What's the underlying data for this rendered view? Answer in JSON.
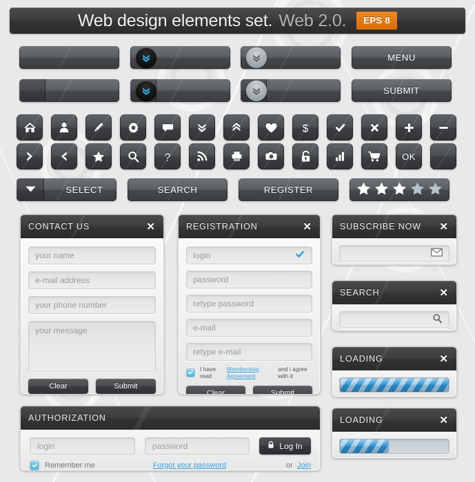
{
  "header": {
    "title_main": "Web design elements set.",
    "title_sub": "Web 2.0.",
    "badge": "EPS 8"
  },
  "buttons": {
    "row1": [
      {
        "name": "plain-button-1",
        "label": ""
      },
      {
        "name": "dropdown-button-dark",
        "label": "",
        "icon": "double-chevron-down-icon"
      },
      {
        "name": "dropdown-button-grey",
        "label": "",
        "icon": "double-chevron-down-icon"
      },
      {
        "name": "menu-button",
        "label": "MENU"
      }
    ],
    "row2": [
      {
        "name": "split-button-1",
        "label": ""
      },
      {
        "name": "split-dropdown-button-dark",
        "label": "",
        "icon": "double-chevron-down-icon"
      },
      {
        "name": "split-dropdown-button-grey",
        "label": "",
        "icon": "double-chevron-down-icon"
      },
      {
        "name": "submit-button",
        "label": "SUBMIT"
      }
    ]
  },
  "icon_tiles": {
    "row1": [
      "home-icon",
      "user-icon",
      "pencil-icon",
      "gear-icon",
      "chat-bubble-icon",
      "double-chevron-down-icon",
      "double-chevron-up-icon",
      "heart-icon",
      "dollar-icon",
      "check-icon",
      "close-x-icon",
      "plus-icon",
      "minus-icon"
    ],
    "row2": [
      "chevron-right-icon",
      "chevron-left-icon",
      "star-icon",
      "magnifier-icon",
      "question-mark-icon",
      "rss-icon",
      "printer-icon",
      "camera-icon",
      "lock-icon",
      "bar-chart-icon",
      "shopping-cart-icon",
      "ok-label",
      "blank-tile"
    ],
    "ok_label": "OK"
  },
  "action_row": {
    "select_label": "SELECT",
    "search_label": "SEARCH",
    "register_label": "REGISTER",
    "rating": {
      "filled": 3,
      "total": 5,
      "filled_color": "#ffffff",
      "empty_color": "#b6c3cc"
    }
  },
  "contact_panel": {
    "title": "CONTACT US",
    "close": "✕",
    "fields": [
      {
        "name": "name-field",
        "placeholder": "your name"
      },
      {
        "name": "email-field",
        "placeholder": "e-mail address"
      },
      {
        "name": "phone-field",
        "placeholder": "your phone number"
      },
      {
        "name": "message-field",
        "placeholder": "your message"
      }
    ],
    "clear_label": "Clear",
    "submit_label": "Submit"
  },
  "registration_panel": {
    "title": "REGISTRATION",
    "close": "✕",
    "fields": [
      {
        "name": "login-field",
        "placeholder": "login",
        "valid": true
      },
      {
        "name": "password-field",
        "placeholder": "password"
      },
      {
        "name": "retype-password-field",
        "placeholder": "retype password"
      },
      {
        "name": "email-field",
        "placeholder": "e-mail"
      },
      {
        "name": "retype-email-field",
        "placeholder": "retype e-mail"
      }
    ],
    "agree_prefix": "I have read",
    "agree_link": "Membership Agreement",
    "agree_suffix": "and i agree with it",
    "clear_label": "Clear",
    "submit_label": "Submit"
  },
  "subscribe_panel": {
    "title": "SUBSCRIBE NOW",
    "close": "✕",
    "field_placeholder": "",
    "icon": "envelope-icon"
  },
  "search_panel": {
    "title": "SEARCH",
    "close": "✕",
    "field_placeholder": "",
    "icon": "magnifier-icon"
  },
  "loading_panels": [
    {
      "title": "LOADING",
      "close": "✕",
      "percent": 100
    },
    {
      "title": "LOADING",
      "close": "✕",
      "percent": 45
    }
  ],
  "authorization_panel": {
    "title": "AUTHORIZATION",
    "close": "",
    "login_placeholder": "login",
    "password_placeholder": "password",
    "login_button": "Log In",
    "login_icon": "lock-icon",
    "remember_label": "Remember me",
    "forgot_link": "Forgot your password",
    "or_text": "or",
    "join_link": "Join"
  },
  "colors": {
    "background": "#e9e9e9",
    "accent_orange": "#e07b18",
    "accent_blue": "#3aa5dd",
    "dark": "#3a3c3f"
  }
}
